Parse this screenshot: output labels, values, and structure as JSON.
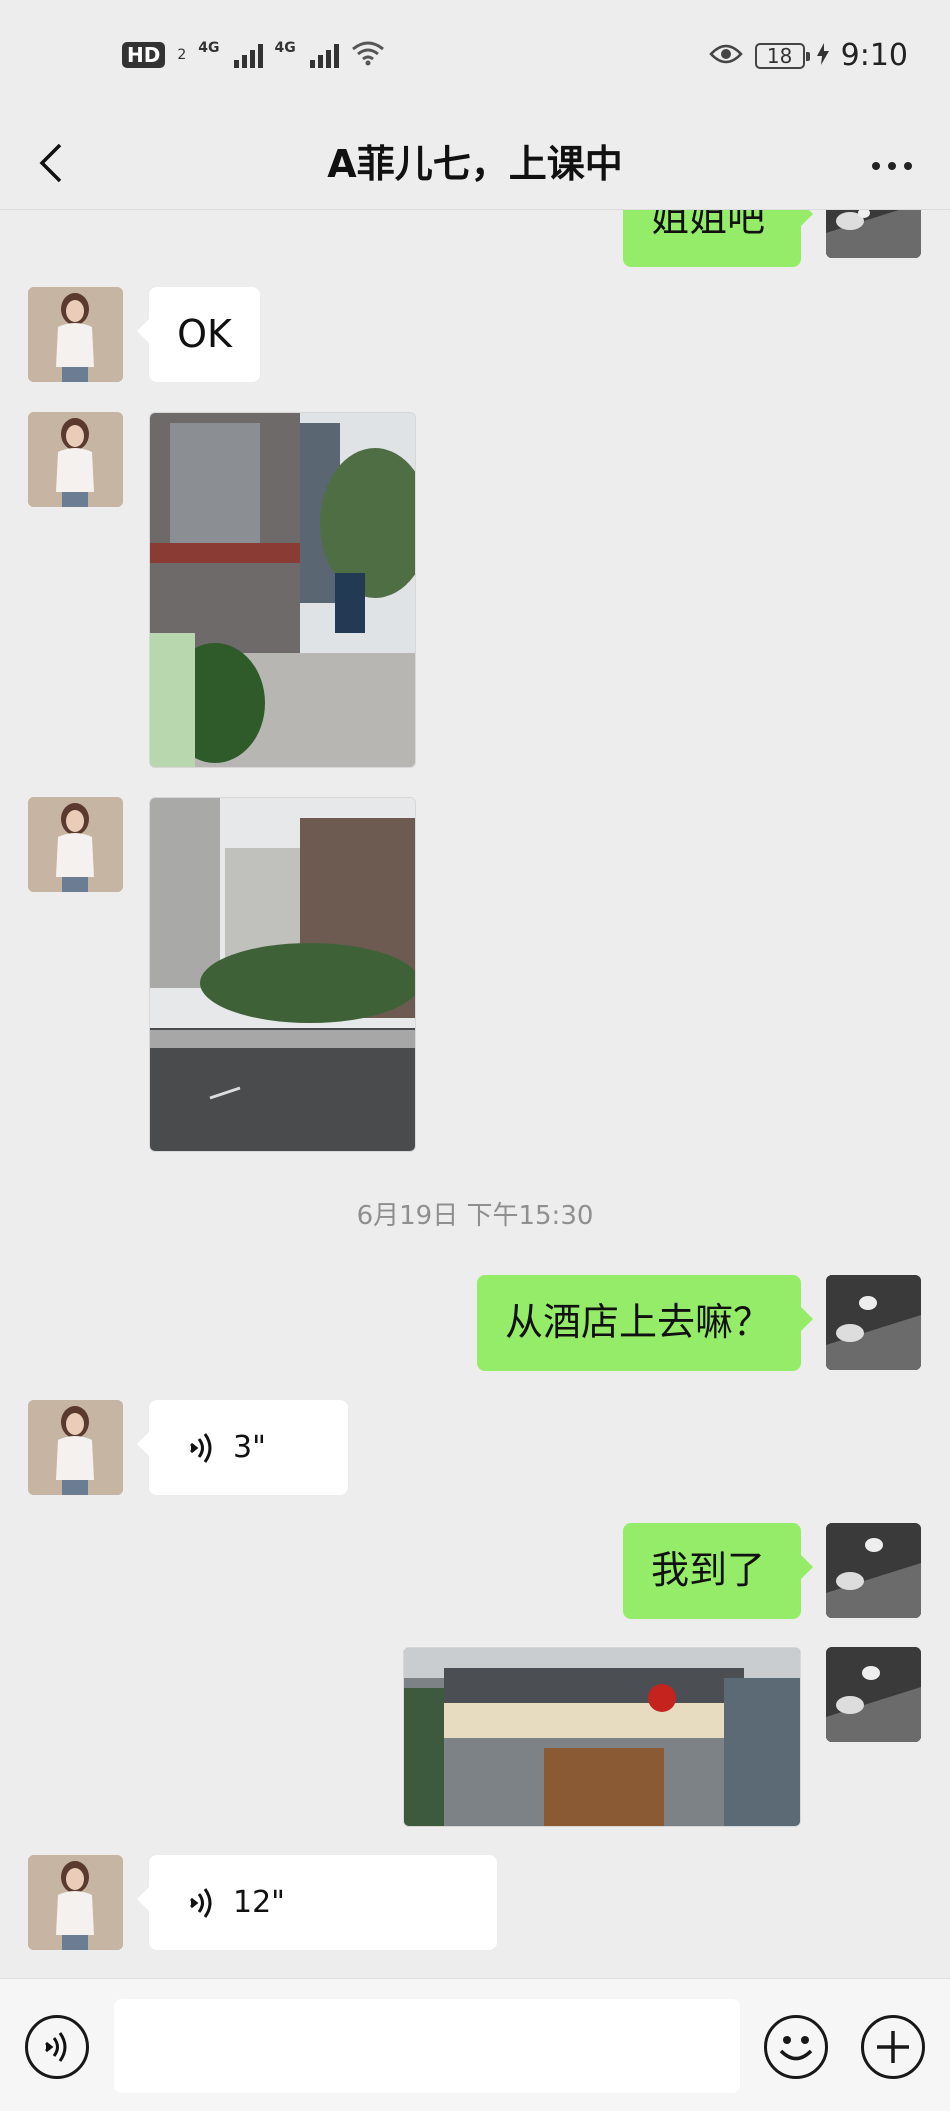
{
  "status_bar": {
    "hd": "HD",
    "sim2": "2",
    "net1": "4G",
    "net2": "4G",
    "battery": "18",
    "time": "9:10"
  },
  "header": {
    "title": "A菲儿七，上课中"
  },
  "messages": {
    "m0_text": "姐姐吧",
    "m1_text": "OK",
    "timestamp": "6月19日 下午15:30",
    "m4_text": "从酒店上去嘛？",
    "m5_duration": "3\"",
    "m6_text": "我到了",
    "m8_duration": "12\""
  },
  "input": {
    "value": "",
    "placeholder": ""
  },
  "colors": {
    "sent_bubble": "#95ec69",
    "received_bubble": "#ffffff",
    "background": "#ededed"
  },
  "icons": {
    "back": "chevron-left-icon",
    "more": "more-dots-icon",
    "voice": "voice-icon",
    "emoji": "emoji-icon",
    "plus": "plus-icon"
  }
}
